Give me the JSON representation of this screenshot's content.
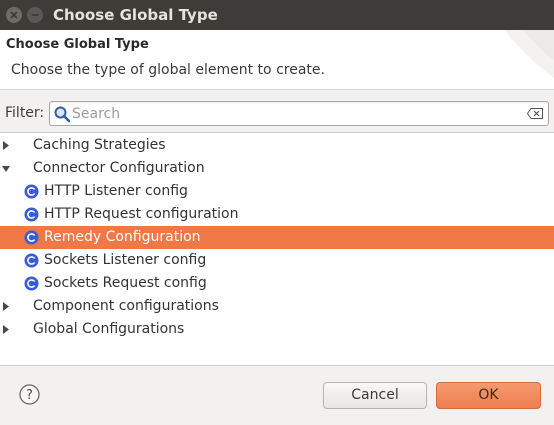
{
  "window": {
    "title": "Choose Global Type"
  },
  "header": {
    "title": "Choose Global Type",
    "description": "Choose the type of global element to create."
  },
  "filter": {
    "label": "Filter:",
    "placeholder": "Search",
    "value": ""
  },
  "tree": {
    "items": [
      {
        "label": "Caching Strategies",
        "kind": "category",
        "expanded": false
      },
      {
        "label": "Connector Configuration",
        "kind": "category",
        "expanded": true
      },
      {
        "label": "HTTP Listener config",
        "kind": "element",
        "icon": "global-element-icon"
      },
      {
        "label": "HTTP Request configuration",
        "kind": "element",
        "icon": "global-element-icon"
      },
      {
        "label": "Remedy Configuration",
        "kind": "element",
        "icon": "global-element-icon",
        "selected": true
      },
      {
        "label": "Sockets Listener config",
        "kind": "element",
        "icon": "global-element-icon"
      },
      {
        "label": "Sockets Request config",
        "kind": "element",
        "icon": "global-element-icon"
      },
      {
        "label": "Component configurations",
        "kind": "category",
        "expanded": false
      },
      {
        "label": "Global Configurations",
        "kind": "category",
        "expanded": false
      }
    ]
  },
  "footer": {
    "help_symbol": "?",
    "cancel_label": "Cancel",
    "ok_label": "OK"
  },
  "colors": {
    "selection": "#f07746",
    "ok_button": "#f28a5c",
    "titlebar": "#3d3c38",
    "element_icon": "#3b5bd6"
  }
}
